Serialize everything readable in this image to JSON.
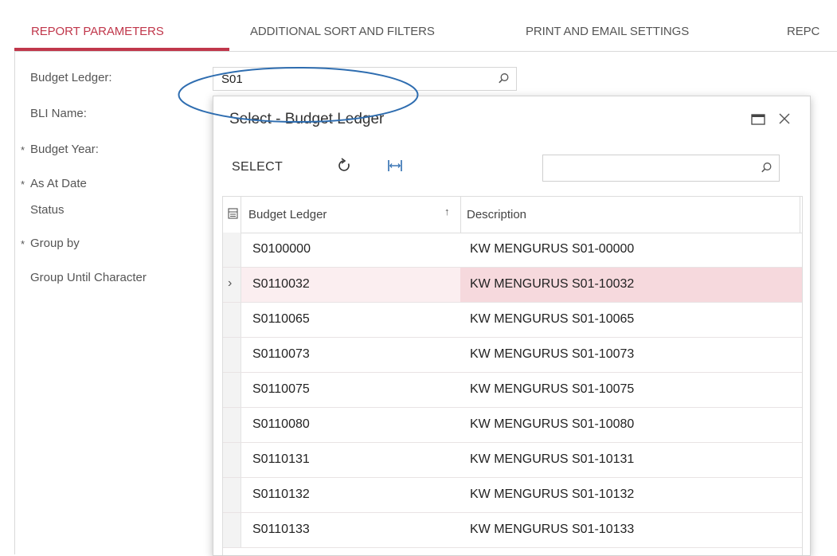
{
  "tabs": [
    {
      "label": "REPORT PARAMETERS",
      "active": true
    },
    {
      "label": "ADDITIONAL SORT AND FILTERS",
      "active": false
    },
    {
      "label": "PRINT AND EMAIL SETTINGS",
      "active": false
    },
    {
      "label": "REPC",
      "active": false
    }
  ],
  "form": {
    "fields": [
      {
        "label": "Budget Ledger:",
        "required": false
      },
      {
        "label": "BLI Name:",
        "required": false
      },
      {
        "label": "Budget Year:",
        "required": true
      },
      {
        "label": "As At Date",
        "required": true
      },
      {
        "label": "Status",
        "required": false
      },
      {
        "label": "Group by",
        "required": true
      },
      {
        "label": "Group Until Character",
        "required": false
      }
    ],
    "budget_ledger_value": "S01"
  },
  "dialog": {
    "title": "Select - Budget Ledger",
    "select_label": "SELECT",
    "search_placeholder": "",
    "columns": [
      "Budget Ledger",
      "Description"
    ],
    "rows": [
      {
        "ledger": "S0100000",
        "description": "KW MENGURUS S01-00000",
        "active": false
      },
      {
        "ledger": "S0110032",
        "description": "KW MENGURUS S01-10032",
        "active": true
      },
      {
        "ledger": "S0110065",
        "description": "KW MENGURUS S01-10065",
        "active": false
      },
      {
        "ledger": "S0110073",
        "description": "KW MENGURUS S01-10073",
        "active": false
      },
      {
        "ledger": "S0110075",
        "description": "KW MENGURUS S01-10075",
        "active": false
      },
      {
        "ledger": "S0110080",
        "description": "KW MENGURUS S01-10080",
        "active": false
      },
      {
        "ledger": "S0110131",
        "description": "KW MENGURUS S01-10131",
        "active": false
      },
      {
        "ledger": "S0110132",
        "description": "KW MENGURUS S01-10132",
        "active": false
      },
      {
        "ledger": "S0110133",
        "description": "KW MENGURUS S01-10133",
        "active": false
      }
    ]
  },
  "icons": {
    "search": "search-icon",
    "maximize": "maximize-icon",
    "close": "close-icon",
    "refresh": "refresh-icon",
    "fit_columns": "fit-columns-icon",
    "column_config": "column-config-icon",
    "sort": "sort-ascending-icon",
    "row_pointer": "chevron-right-icon"
  },
  "colors": {
    "accent": "#c0374b",
    "annotation": "#2e6db0",
    "active_row": "#fbeef0",
    "active_cell": "#f6d9dd"
  }
}
